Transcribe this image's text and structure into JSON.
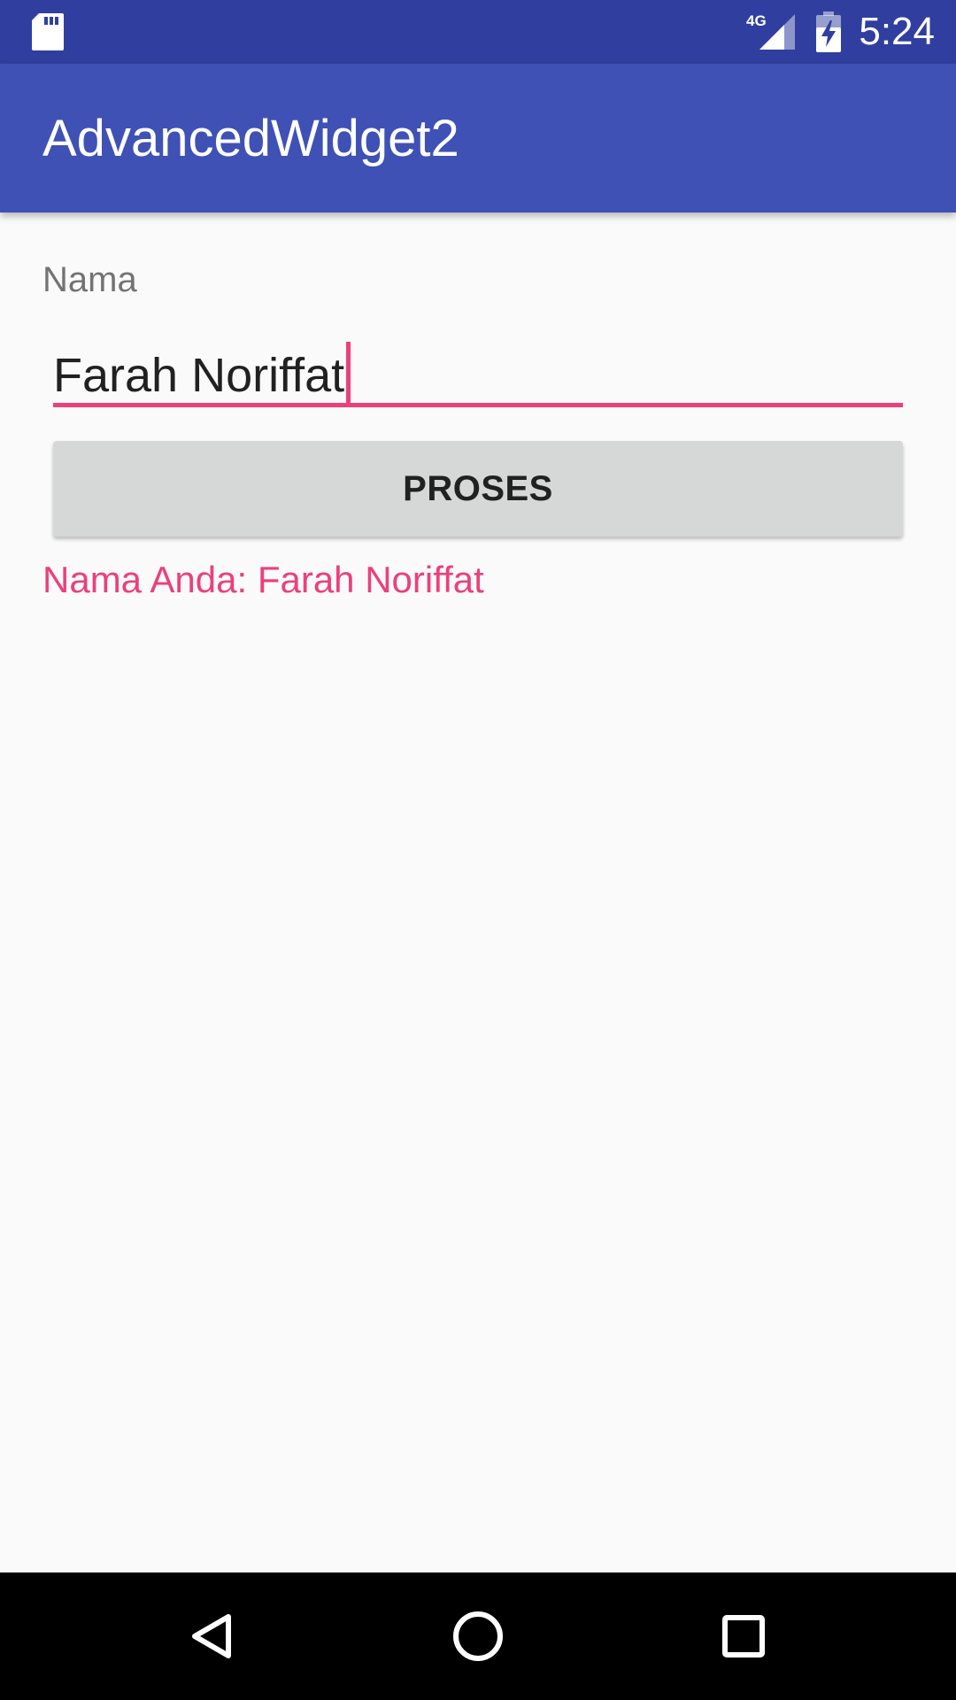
{
  "status_bar": {
    "time": "5:24",
    "network": "4G",
    "icons": [
      "sd-card-icon",
      "signal-4g-icon",
      "battery-charging-icon"
    ],
    "background_color": "#303F9F"
  },
  "app_bar": {
    "title": "AdvancedWidget2",
    "background_color": "#3F51B5"
  },
  "form": {
    "name_label": "Nama",
    "name_input_value": "Farah Noriffat",
    "accent_color": "#EC407A",
    "submit_label": "PROSES",
    "result_text": "Nama Anda: Farah Noriffat"
  },
  "nav_bar": {
    "buttons": [
      "back-icon",
      "home-icon",
      "recents-icon"
    ]
  }
}
